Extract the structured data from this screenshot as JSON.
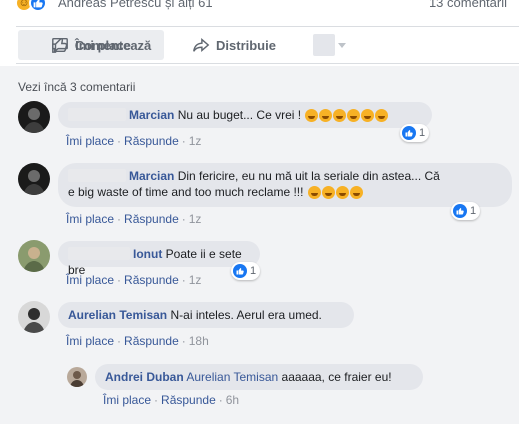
{
  "post": {
    "reaction_text": "Andreas Petrescu și alți 61",
    "comment_count": "13 comentarii",
    "reactions": [
      "haha-icon",
      "like-icon"
    ]
  },
  "actions": {
    "like": "Îmi place",
    "comment": "Comentează",
    "share": "Distribuie"
  },
  "see_more": "Vezi încă 3 comentarii",
  "comments": [
    {
      "author": "Marcian",
      "text": "Nu au buget... Ce vrei !",
      "emoji_count": 6,
      "like_label": "Îmi place",
      "reply_label": "Răspunde",
      "time": "1z",
      "likes": "1"
    },
    {
      "author": "Marcian",
      "text_line1": "Din fericire, eu nu mă uit la seriale din astea... Că",
      "text_line2": "e big waste of time and too much reclame !!!",
      "emoji_count": 4,
      "like_label": "Îmi place",
      "reply_label": "Răspunde",
      "time": "1z",
      "likes": "1"
    },
    {
      "author": "Ionut",
      "text": "Poate ii e sete bre",
      "like_label": "Îmi place",
      "reply_label": "Răspunde",
      "time": "1z",
      "likes": "1"
    },
    {
      "author": "Aurelian Temisan",
      "text": "N-ai inteles. Aerul era umed.",
      "like_label": "Îmi place",
      "reply_label": "Răspunde",
      "time": "18h"
    }
  ],
  "reply": {
    "author": "Andrei Duban",
    "tag": "Aurelian Temisan",
    "text": "aaaaaa, ce fraier eu!",
    "like_label": "Îmi place",
    "reply_label": "Răspunde",
    "time": "6h"
  },
  "colors": {
    "link": "#385898",
    "bubble": "#e4e6eb",
    "section_bg": "#f2f3f5",
    "like_blue": "#1877f2"
  }
}
